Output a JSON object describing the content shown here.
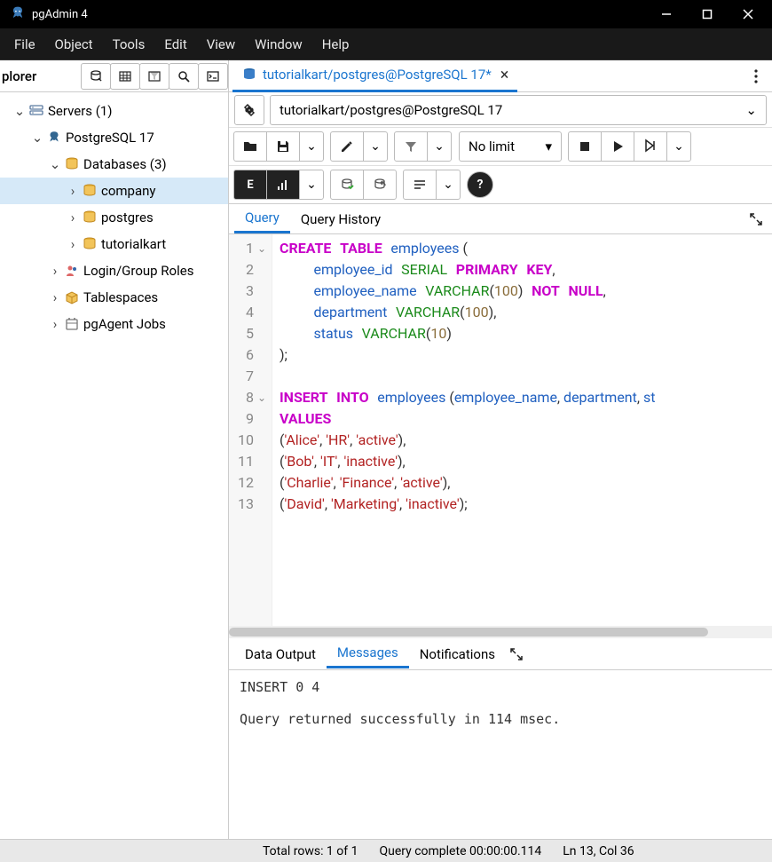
{
  "window": {
    "title": "pgAdmin 4"
  },
  "menu": [
    "File",
    "Object",
    "Tools",
    "Edit",
    "View",
    "Window",
    "Help"
  ],
  "explorer": {
    "label": "plorer"
  },
  "tree": {
    "servers": "Servers (1)",
    "pg": "PostgreSQL 17",
    "databases": "Databases (3)",
    "db_company": "company",
    "db_postgres": "postgres",
    "db_tutorialkart": "tutorialkart",
    "login_roles": "Login/Group Roles",
    "tablespaces": "Tablespaces",
    "pgagent": "pgAgent Jobs"
  },
  "tab": {
    "label": "tutorialkart/postgres@PostgreSQL 17*"
  },
  "connection": {
    "selected": "tutorialkart/postgres@PostgreSQL 17"
  },
  "limit": {
    "label": "No limit"
  },
  "editor_tabs": {
    "query": "Query",
    "history": "Query History"
  },
  "code": {
    "lines": [
      {
        "n": 1,
        "fold": true
      },
      {
        "n": 2
      },
      {
        "n": 3
      },
      {
        "n": 4
      },
      {
        "n": 5
      },
      {
        "n": 6
      },
      {
        "n": 7
      },
      {
        "n": 8,
        "fold": true
      },
      {
        "n": 9
      },
      {
        "n": 10
      },
      {
        "n": 11
      },
      {
        "n": 12
      },
      {
        "n": 13
      }
    ],
    "l1_create": "CREATE",
    "l1_table": "TABLE",
    "l1_name": "employees",
    "l1_p": " (",
    "l2_col": "employee_id",
    "l2_ty": "SERIAL",
    "l2_pk": "PRIMARY",
    "l2_key": "KEY",
    "l2_c": ",",
    "l3_col": "employee_name",
    "l3_ty": "VARCHAR",
    "l3_n": "100",
    "l3_not": "NOT",
    "l3_null": "NULL",
    "l3_c": ",",
    "l4_col": "department",
    "l4_ty": "VARCHAR",
    "l4_n": "100",
    "l4_c": ",",
    "l5_col": "status",
    "l5_ty": "VARCHAR",
    "l5_n": "10",
    "l6": ");",
    "l8_ins": "INSERT",
    "l8_into": "INTO",
    "l8_tbl": "employees",
    "l8_rest": " (",
    "l8_c1": "employee_name",
    "l8_sep1": ", ",
    "l8_c2": "department",
    "l8_sep2": ", ",
    "l8_c3": "st",
    "l9": "VALUES",
    "l10_a": "'Alice'",
    "l10_b": "'HR'",
    "l10_c": "'active'",
    "l11_a": "'Bob'",
    "l11_b": "'IT'",
    "l11_c": "'inactive'",
    "l12_a": "'Charlie'",
    "l12_b": "'Finance'",
    "l12_c": "'active'",
    "l13_a": "'David'",
    "l13_b": "'Marketing'",
    "l13_c": "'inactive'"
  },
  "output_tabs": {
    "data": "Data Output",
    "messages": "Messages",
    "notifications": "Notifications"
  },
  "messages": "INSERT 0 4\n\nQuery returned successfully in 114 msec.",
  "status": {
    "rows": "Total rows: 1 of 1",
    "complete": "Query complete 00:00:00.114",
    "cursor": "Ln 13, Col 36"
  }
}
